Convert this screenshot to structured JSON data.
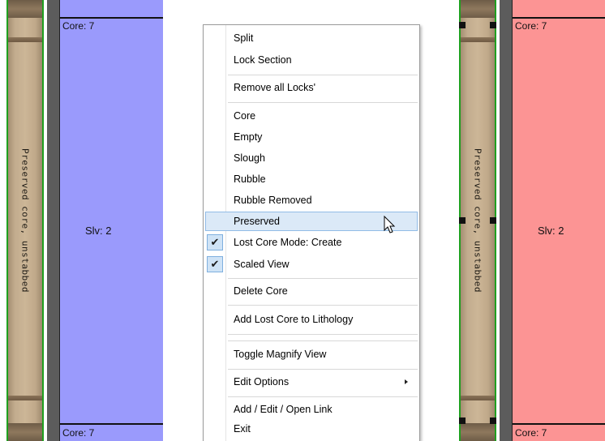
{
  "left_panel": {
    "core_top_label": "Core: 7",
    "core_bottom_label": "Core: 7",
    "section_label": "Slv: 2",
    "strip_label": "Preserved core, unstabbed",
    "section_color": "#9a9afc"
  },
  "right_panel": {
    "core_top_label": "Core: 7",
    "core_bottom_label": "Core: 7",
    "section_label": "Slv: 2",
    "strip_label": "Preserved core, unstabbed",
    "section_color": "#fc9494"
  },
  "context_menu": {
    "items": [
      {
        "label": "Split"
      },
      {
        "label": "Lock Section"
      },
      {
        "label": "Remove all Locks'"
      },
      {
        "label": "Core"
      },
      {
        "label": "Empty"
      },
      {
        "label": "Slough"
      },
      {
        "label": "Rubble"
      },
      {
        "label": "Rubble Removed"
      },
      {
        "label": "Preserved",
        "highlighted": true
      },
      {
        "label": "Lost Core Mode: Create",
        "checked": true
      },
      {
        "label": "Scaled View",
        "checked": true
      },
      {
        "label": "Delete Core"
      },
      {
        "label": "Add Lost Core to Lithology"
      },
      {
        "label": "Toggle Magnify View"
      },
      {
        "label": "Edit Options",
        "submenu": true
      },
      {
        "label": "Add / Edit / Open Link"
      },
      {
        "label": "Exit"
      }
    ],
    "check_glyph": "✔"
  },
  "icons": {
    "checkmark": "check-icon",
    "submenu": "submenu-arrow-icon",
    "pointer": "mouse-pointer-icon"
  }
}
